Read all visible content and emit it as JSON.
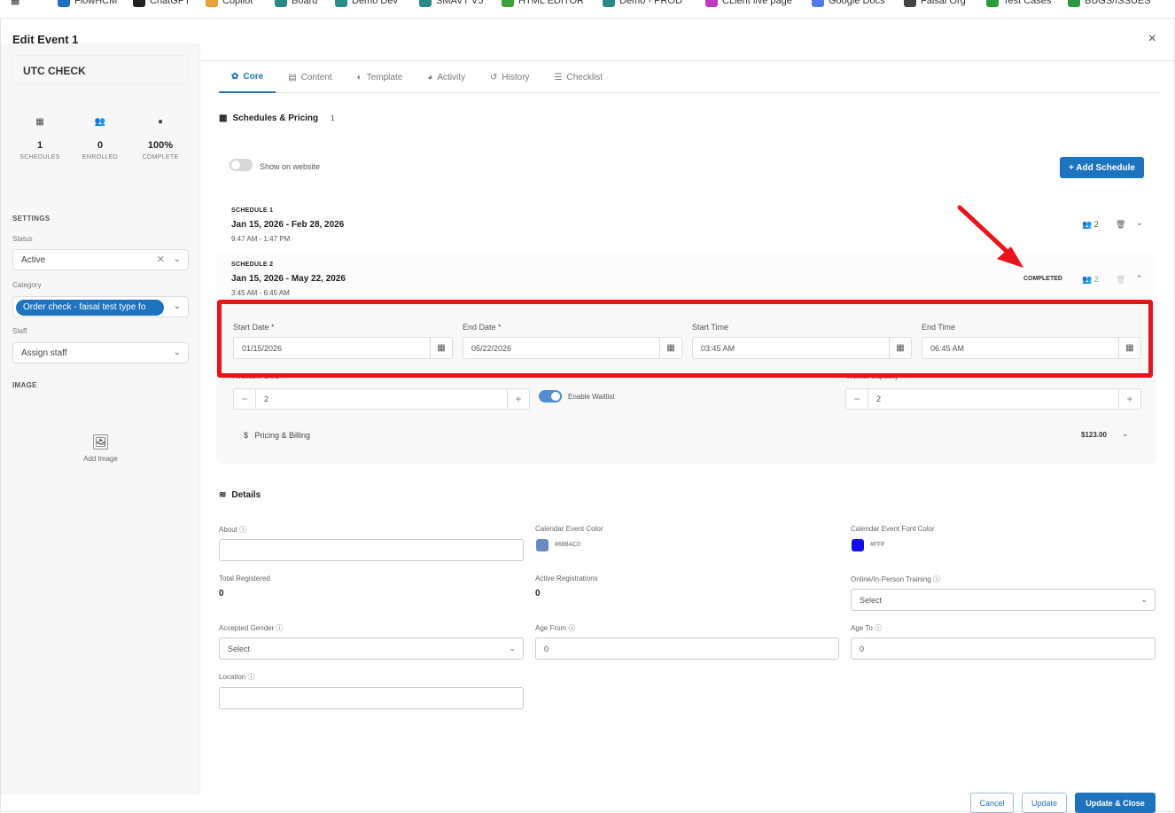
{
  "bookmarks": [
    {
      "label": "FlowHCM",
      "color": "#1e73be"
    },
    {
      "label": "ChatGPT",
      "color": "#222222"
    },
    {
      "label": "Copilot",
      "color": "#e8a23a"
    },
    {
      "label": "Board",
      "color": "#2a8a8a"
    },
    {
      "label": "Demo Dev",
      "color": "#2a8a8a"
    },
    {
      "label": "SMAVT V5",
      "color": "#2a8a8a"
    },
    {
      "label": "HTML EDITOR",
      "color": "#3aa23a"
    },
    {
      "label": "Demo - PROD",
      "color": "#2a8a8a"
    },
    {
      "label": "CLient live page",
      "color": "#c03ac0"
    },
    {
      "label": "Google Docs",
      "color": "#4a7be8"
    },
    {
      "label": "Faisal Org",
      "color": "#444444"
    },
    {
      "label": "Test Cases",
      "color": "#2a9a3a"
    },
    {
      "label": "BUGS/ISSUES",
      "color": "#2a9a3a"
    }
  ],
  "modal": {
    "title": "Edit Event 1",
    "close": "×"
  },
  "sidebar": {
    "name": "UTC CHECK",
    "stats": [
      {
        "icon": "calendar-icon",
        "glyph": "▦",
        "value": "1",
        "label": "SCHEDULES"
      },
      {
        "icon": "users-icon",
        "glyph": "👥",
        "value": "0",
        "label": "ENROLLED"
      },
      {
        "icon": "check-circle-icon",
        "glyph": "●",
        "value": "100%",
        "label": "COMPLETE"
      }
    ],
    "settings_label": "SETTINGS",
    "status_label": "Status",
    "status_value": "Active",
    "category_label": "Category",
    "category_value": "Order check - faisal test type fo",
    "staff_label": "Staff",
    "staff_placeholder": "Assign staff",
    "image_label": "IMAGE",
    "add_image": "Add Image"
  },
  "tabs": [
    {
      "label": "Core",
      "glyph": "✿",
      "icon": "gear-icon",
      "active": true
    },
    {
      "label": "Content",
      "glyph": "▤",
      "icon": "file-icon",
      "active": false
    },
    {
      "label": "Template",
      "glyph": "◐",
      "icon": "palette-icon",
      "active": false
    },
    {
      "label": "Activity",
      "glyph": "◕",
      "icon": "chat-icon",
      "active": false
    },
    {
      "label": "History",
      "glyph": "↺",
      "icon": "history-icon",
      "active": false
    },
    {
      "label": "Checklist",
      "glyph": "☰",
      "icon": "checklist-icon",
      "active": false
    }
  ],
  "schedules": {
    "heading": "Schedules & Pricing",
    "count": "1",
    "show_on_website": "Show on website",
    "add_button": "+ Add Schedule",
    "items": [
      {
        "label": "SCHEDULE 1",
        "dates": "Jan 15, 2026 - Feb 28, 2026",
        "times": "9:47 AM - 1:47 PM",
        "enrolled": "2",
        "status": ""
      },
      {
        "label": "SCHEDULE 2",
        "dates": "Jan 15, 2026 - May 22, 2026",
        "times": "3:45 AM - 6:45 AM",
        "enrolled": "2",
        "status": "COMPLETED"
      }
    ],
    "form": {
      "start_date_label": "Start Date *",
      "start_date": "01/15/2026",
      "end_date_label": "End Date *",
      "end_date": "05/22/2026",
      "start_time_label": "Start Time",
      "start_time": "03:45 AM",
      "end_time_label": "End Time",
      "end_time": "06:45 AM",
      "available_slots_label": "Available Slots",
      "available_slots": "2",
      "enable_waitlist": "Enable Waitlist",
      "waitlist_capacity_label": "Waitlist Capacity",
      "waitlist_capacity": "2",
      "pricing_label": "Pricing & Billing",
      "pricing_symbol": "$",
      "price": "$123.00"
    }
  },
  "details": {
    "heading": "Details",
    "about_label": "About",
    "calendar_color_label": "Calendar Event Color",
    "calendar_color": "#688AC0",
    "calendar_font_color_label": "Calendar Event Font Color",
    "calendar_font_color": "#FFF",
    "calendar_font_swatch": "#1010ee",
    "total_registered_label": "Total Registered",
    "total_registered": "0",
    "active_registrations_label": "Active Registrations",
    "active_registrations": "0",
    "training_label": "Online/In-Person Training",
    "training_value": "Select",
    "gender_label": "Accepted Gender",
    "gender_value": "Select",
    "age_from_label": "Age From",
    "age_from": "0",
    "age_to_label": "Age To",
    "age_to": "0",
    "location_label": "Location"
  },
  "footer": {
    "cancel": "Cancel",
    "update": "Update",
    "update_close": "Update & Close"
  },
  "colors": {
    "accent": "#1e73be",
    "highlight": "#e8141a"
  }
}
